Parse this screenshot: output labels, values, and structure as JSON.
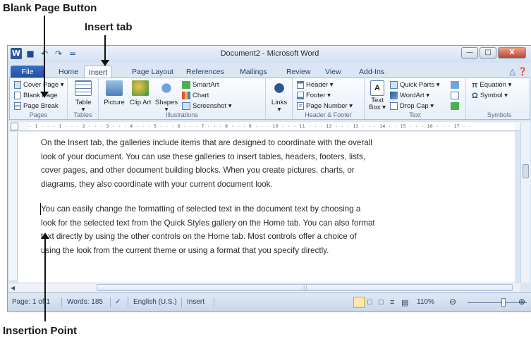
{
  "annotations": {
    "blank_page_button": "Blank Page Button",
    "insert_tab": "Insert tab",
    "insertion_point": "Insertion Point"
  },
  "window": {
    "title": "Document2 - Microsoft Word",
    "qat": [
      "W",
      "■",
      "↶",
      "↷",
      "="
    ]
  },
  "tabs": [
    "File",
    "Home",
    "Insert",
    "Page Layout",
    "References",
    "Mailings",
    "Review",
    "View",
    "Add-Ins"
  ],
  "ribbon": {
    "pages": {
      "label": "Pages",
      "cover_page": "Cover Page ▾",
      "blank_page": "Blank Page",
      "page_break": "Page Break"
    },
    "tables": {
      "label": "Tables",
      "table": "Table"
    },
    "illustrations": {
      "label": "Illustrations",
      "picture": "Picture",
      "clip_art": "Clip Art",
      "shapes": "Shapes",
      "smartart": "SmartArt",
      "chart": "Chart",
      "screenshot": "Screenshot ▾"
    },
    "links": {
      "label": "",
      "links": "Links"
    },
    "header_footer": {
      "label": "Header & Footer",
      "header": "Header ▾",
      "footer": "Footer ▾",
      "page_number": "Page Number ▾"
    },
    "text": {
      "label": "Text",
      "text_box": "Text Box ▾",
      "quick_parts": "Quick Parts ▾",
      "wordart": "WordArt ▾",
      "drop_cap": "Drop Cap ▾"
    },
    "symbols": {
      "label": "Symbols",
      "equation": "Equation ▾",
      "symbol": "Symbol ▾"
    }
  },
  "ruler_text": "· 1 · · · 1 · · · 2 · · · 3 · · · 4 · · · 5 · · · 6 · · · 7 · · · 8 · · · 9 · · · 10 · · · 11 · · · 12 · · · 13 · · · 14 · · 15 · · · 16 · · · 17 · ·",
  "document": {
    "paragraphs": [
      [
        "On the Insert tab, the galleries include items that are designed to coordinate with the overall",
        "look of your document. You can use these galleries to insert tables, headers, footers, lists,",
        "cover pages, and other document building blocks. When you create pictures, charts, or",
        "diagrams, they also coordinate with your current document look."
      ],
      [
        "You can easily change the formatting of selected text in the document text by choosing a",
        "look for the selected text from the Quick Styles gallery on the Home tab. You can also format",
        "text directly by using the other controls on the Home tab. Most controls offer a choice of",
        "using the look from the current theme or using a format that you specify directly."
      ]
    ]
  },
  "status": {
    "page": "Page: 1 of 1",
    "words": "Words: 185",
    "language": "English (U.S.)",
    "mode": "Insert",
    "zoom": "110%"
  },
  "colors": {
    "file_tab": "#2b5797",
    "chrome": "#dbe6f4"
  }
}
